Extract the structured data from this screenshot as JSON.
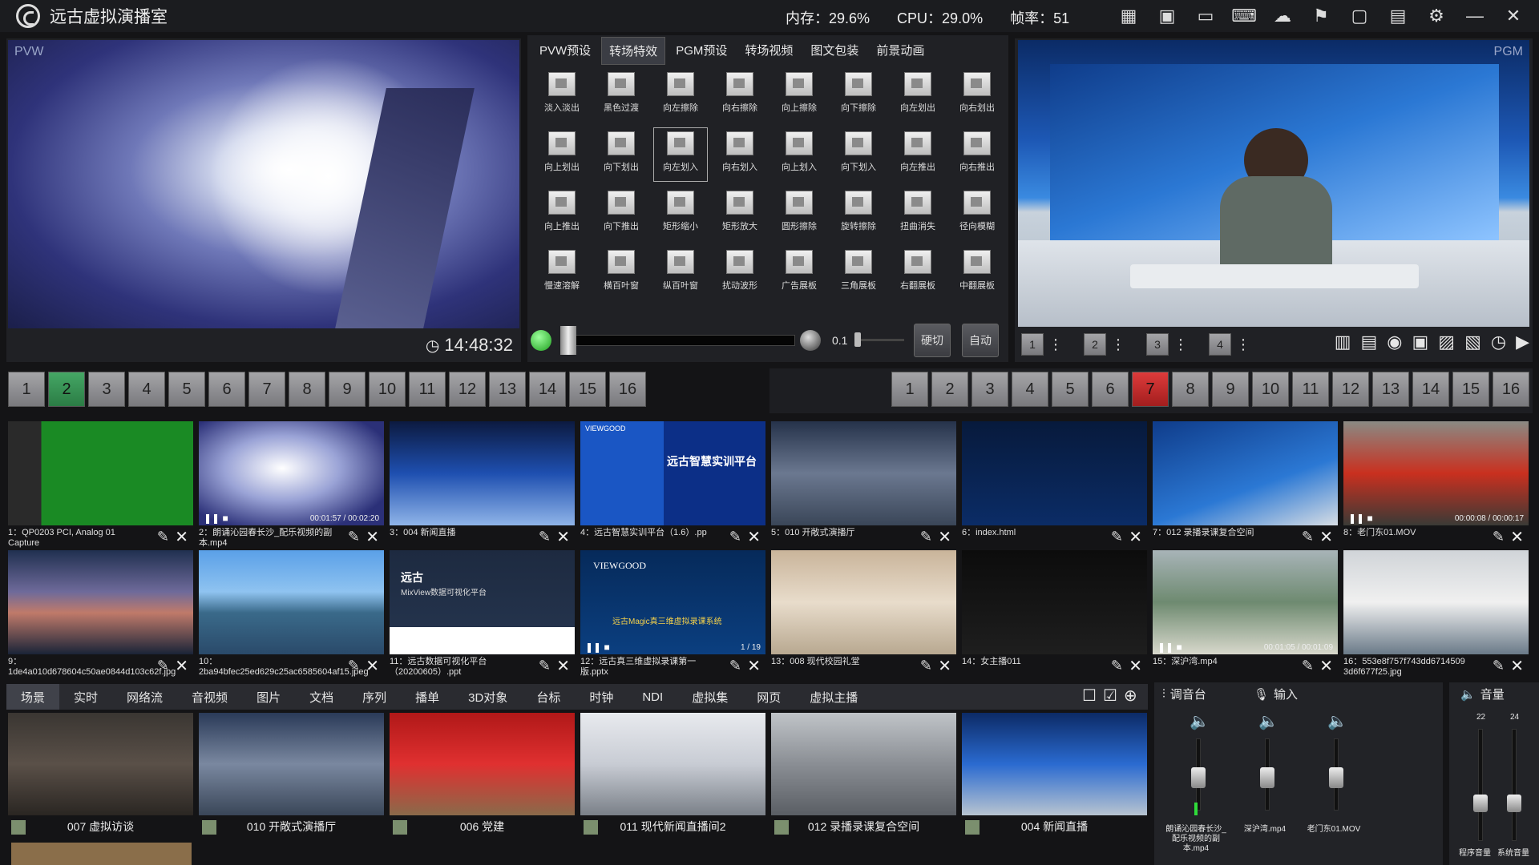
{
  "app": {
    "title": "远古虚拟演播室"
  },
  "stats": {
    "memory": "内存：29.6%",
    "cpu": "CPU：29.0%",
    "fps": "帧率：51"
  },
  "preview": {
    "label": "PVW",
    "clock": "14:48:32"
  },
  "program": {
    "label": "PGM"
  },
  "transition_tabs": [
    "PVW预设",
    "转场特效",
    "PGM预设",
    "转场视频",
    "图文包装",
    "前景动画"
  ],
  "transitions": [
    "淡入淡出",
    "黑色过渡",
    "向左擦除",
    "向右擦除",
    "向上擦除",
    "向下擦除",
    "向左划出",
    "向右划出",
    "向上划出",
    "向下划出",
    "向左划入",
    "向右划入",
    "向上划入",
    "向下划入",
    "向左推出",
    "向右推出",
    "向上推出",
    "向下推出",
    "矩形缩小",
    "矩形放大",
    "圆形擦除",
    "旋转擦除",
    "扭曲消失",
    "径向模糊",
    "慢速溶解",
    "横百叶窗",
    "纵百叶窗",
    "扰动波形",
    "广告展板",
    "三角展板",
    "右翻展板",
    "中翻展板"
  ],
  "controls": {
    "speed": "0.1",
    "hard_cut": "硬切",
    "auto": "自动"
  },
  "pgm_layers": [
    "1",
    "2",
    "3",
    "4"
  ],
  "pvw_numbers": {
    "active": 2,
    "labels": [
      "1",
      "2",
      "3",
      "4",
      "5",
      "6",
      "7",
      "8",
      "9",
      "10",
      "11",
      "12",
      "13",
      "14",
      "15",
      "16"
    ]
  },
  "pgm_numbers": {
    "active": 7,
    "labels": [
      "1",
      "2",
      "3",
      "4",
      "5",
      "6",
      "7",
      "8",
      "9",
      "10",
      "11",
      "12",
      "13",
      "14",
      "15",
      "16"
    ]
  },
  "media": [
    {
      "caption": "1：QP0203 PCI, Analog 01 Capture",
      "time": ""
    },
    {
      "caption": "2：朗诵沁园春长沙_配乐视频的副本.mp4",
      "time": "00:01:57 / 00:02:20"
    },
    {
      "caption": "3：004 新闻直播",
      "time": ""
    },
    {
      "caption": "4：远古智慧实训平台（1.6）.pp",
      "time": ""
    },
    {
      "caption": "5：010 开敞式演播厅",
      "time": ""
    },
    {
      "caption": "6：index.html",
      "time": ""
    },
    {
      "caption": "7：012 录播录课复合空间",
      "time": ""
    },
    {
      "caption": "8：老门东01.MOV",
      "time": "00:00:08 / 00:00:17"
    },
    {
      "caption": "9：1de4a010d678604c50ae0844d103c62f.jpg",
      "time": ""
    },
    {
      "caption": "10：2ba94bfec25ed629c25ac6585604af15.jpeg",
      "time": ""
    },
    {
      "caption": "11：远古数据可视化平台（20200605）.ppt",
      "time": ""
    },
    {
      "caption": "12：远古真三维虚拟录课第一版.pptx",
      "time": "1 / 19"
    },
    {
      "caption": "13：008 现代校园礼堂",
      "time": ""
    },
    {
      "caption": "14：女主播011",
      "time": ""
    },
    {
      "caption": "15：深沪湾.mp4",
      "time": "00:01:05 / 00:01:09"
    },
    {
      "caption": "16：553e8f757f743dd6714509 3d6f677f25.jpg",
      "time": ""
    }
  ],
  "media_text": {
    "m4_title": "远古智慧实训平台",
    "m4_brand": "VIEWGOOD",
    "m11_title": "远古",
    "m11_sub": "MixView数据可视化平台",
    "m12_brand": "VIEWGOOD",
    "m12_title": "远古Magic真三维虚拟录课系统"
  },
  "bottom_tabs": [
    "场景",
    "实时",
    "网络流",
    "音视频",
    "图片",
    "文档",
    "序列",
    "播单",
    "3D对象",
    "台标",
    "时钟",
    "NDI",
    "虚拟集",
    "网页",
    "虚拟主播"
  ],
  "scenes": [
    "007 虚拟访谈",
    "010 开敞式演播厅",
    "006 党建",
    "011 现代新闻直播间2",
    "012 录播录课复合空间",
    "004 新闻直播"
  ],
  "mixer": {
    "title": "调音台",
    "input": "输入",
    "channels": [
      "朗诵沁园春长沙_配乐视频的副本.mp4",
      "深沪湾.mp4",
      "老门东01.MOV"
    ]
  },
  "volume": {
    "title": "音量",
    "program_label": "程序音量",
    "system_label": "系统音量",
    "program_value": "22",
    "system_value": "24"
  }
}
